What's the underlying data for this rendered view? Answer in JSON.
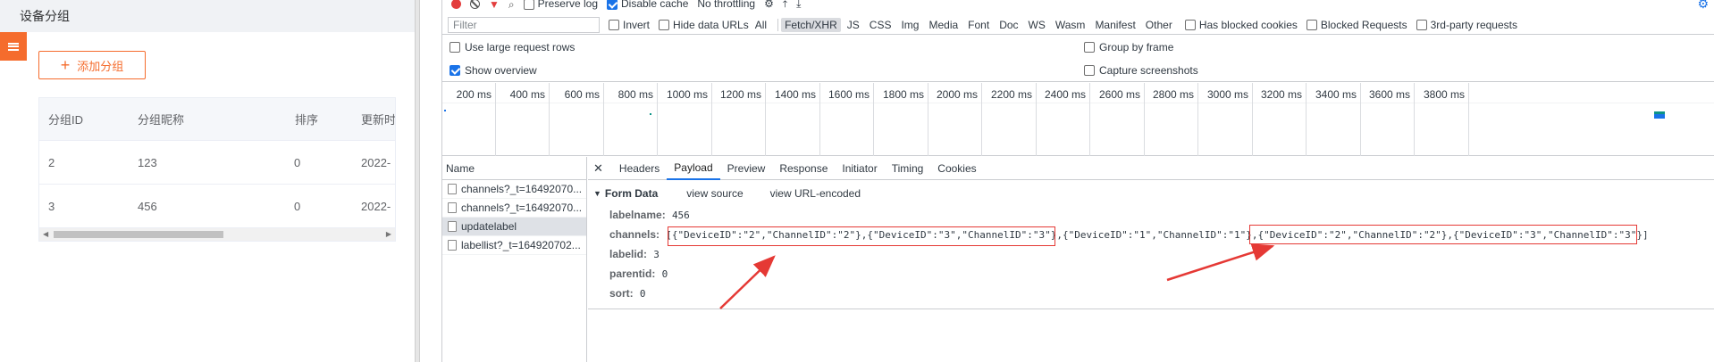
{
  "app": {
    "title": "设备分组",
    "add_button": "添加分组",
    "table": {
      "columns": [
        "分组ID",
        "分组昵称",
        "排序",
        "更新时"
      ],
      "rows": [
        {
          "id": "2",
          "name": "123",
          "sort": "0",
          "updated": "2022-"
        },
        {
          "id": "3",
          "name": "456",
          "sort": "0",
          "updated": "2022-"
        }
      ]
    }
  },
  "devtools": {
    "toolbar": {
      "preserve_log": "Preserve log",
      "disable_cache": "Disable cache",
      "throttling": "No throttling"
    },
    "filter": {
      "placeholder": "Filter",
      "invert": "Invert",
      "hide_data_urls": "Hide data URLs",
      "types": [
        "All",
        "Fetch/XHR",
        "JS",
        "CSS",
        "Img",
        "Media",
        "Font",
        "Doc",
        "WS",
        "Wasm",
        "Manifest",
        "Other"
      ],
      "selected_type": "Fetch/XHR",
      "has_blocked_cookies": "Has blocked cookies",
      "blocked_requests": "Blocked Requests",
      "third_party": "3rd-party requests"
    },
    "options": {
      "large_rows": "Use large request rows",
      "show_overview": "Show overview",
      "group_by_frame": "Group by frame",
      "capture_screenshots": "Capture screenshots"
    },
    "timeline_ticks": [
      "200 ms",
      "400 ms",
      "600 ms",
      "800 ms",
      "1000 ms",
      "1200 ms",
      "1400 ms",
      "1600 ms",
      "1800 ms",
      "2000 ms",
      "2200 ms",
      "2400 ms",
      "2600 ms",
      "2800 ms",
      "3000 ms",
      "3200 ms",
      "3400 ms",
      "3600 ms",
      "3800 ms"
    ],
    "request_list": {
      "header": "Name",
      "items": [
        "channels?_t=16492070...",
        "channels?_t=16492070...",
        "updatelabel",
        "labellist?_t=164920702..."
      ],
      "selected_index": 2
    },
    "tabs": [
      "Headers",
      "Payload",
      "Preview",
      "Response",
      "Initiator",
      "Timing",
      "Cookies"
    ],
    "active_tab": "Payload",
    "payload": {
      "section_title": "Form Data",
      "view_source": "view source",
      "view_url_encoded": "view URL-encoded",
      "fields": [
        {
          "key": "labelname:",
          "value": "456"
        },
        {
          "key": "channels:",
          "value": "[{\"DeviceID\":\"2\",\"ChannelID\":\"2\"},{\"DeviceID\":\"3\",\"ChannelID\":\"3\"},{\"DeviceID\":\"1\",\"ChannelID\":\"1\"},{\"DeviceID\":\"2\",\"ChannelID\":\"2\"},{\"DeviceID\":\"3\",\"ChannelID\":\"3\"}]"
        },
        {
          "key": "labelid:",
          "value": "3"
        },
        {
          "key": "parentid:",
          "value": "0"
        },
        {
          "key": "sort:",
          "value": "0"
        }
      ]
    }
  },
  "colors": {
    "accent": "#f56c2d",
    "devtools_blue": "#1a73e8",
    "annotation_red": "#e53935"
  }
}
